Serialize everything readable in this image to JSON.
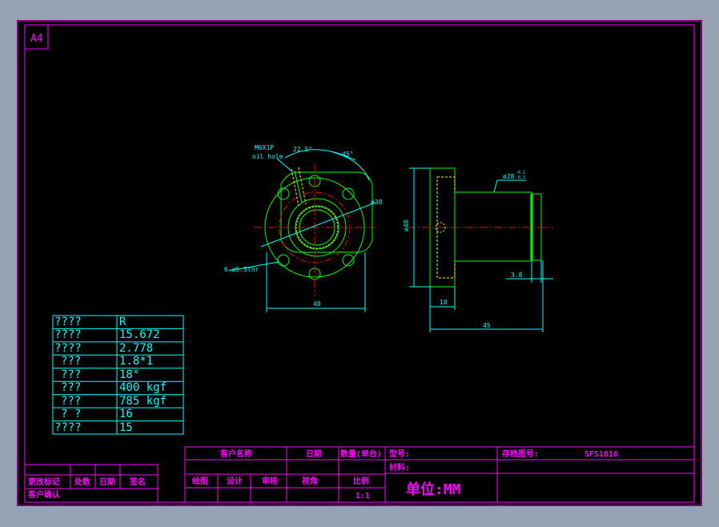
{
  "sheet": {
    "size_label": "A4"
  },
  "spec_table": {
    "rows": [
      {
        "label": "????",
        "value": "R"
      },
      {
        "label": "????",
        "value": "15.672"
      },
      {
        "label": "????",
        "value": "2.778"
      },
      {
        "label": "???",
        "value": "1.8*1"
      },
      {
        "label": "???",
        "value": "18°"
      },
      {
        "label": "???",
        "value": "400 kgf"
      },
      {
        "label": "???",
        "value": "785 kgf"
      },
      {
        "label": "?  ?",
        "value": "16"
      },
      {
        "label": "????",
        "value": "15"
      }
    ]
  },
  "revision_block": {
    "change_mark": "更改标记",
    "location": "处数",
    "date": "日期",
    "signature": "签名",
    "customer_confirm": "客户确认"
  },
  "title_block": {
    "customer_name": "客户名称",
    "date": "日期",
    "quantity": "数量(单台)",
    "model_label": "型号:",
    "archive_label": "存档图号:",
    "archive_value": "SFS1616",
    "material_label": "材料:",
    "drawn": "绘图",
    "design": "设计",
    "review": "审核",
    "projection": "视角",
    "scale_label": "比例",
    "scale_value": "1:1",
    "unit": "单位:MM"
  },
  "drawing": {
    "oil_hole": "M6X1P",
    "oil_hole_note": "oil hole",
    "angle_a": "22.5°",
    "angle_b": "45°",
    "bolt_circle": "ø38",
    "holes": "6-ø5.5thr",
    "width": "40",
    "flange_dia": "ø48",
    "body_dia": "ø28",
    "body_tol_upper": "-0.1",
    "body_tol_lower": "-0.3",
    "flange_thk": "10",
    "length": "45",
    "groove": "3.8"
  },
  "colors": {
    "border": "#ff00ff",
    "table": "#00ffff",
    "part": "#00ff00",
    "center": "#ff0000",
    "dim": "#00ffff"
  }
}
